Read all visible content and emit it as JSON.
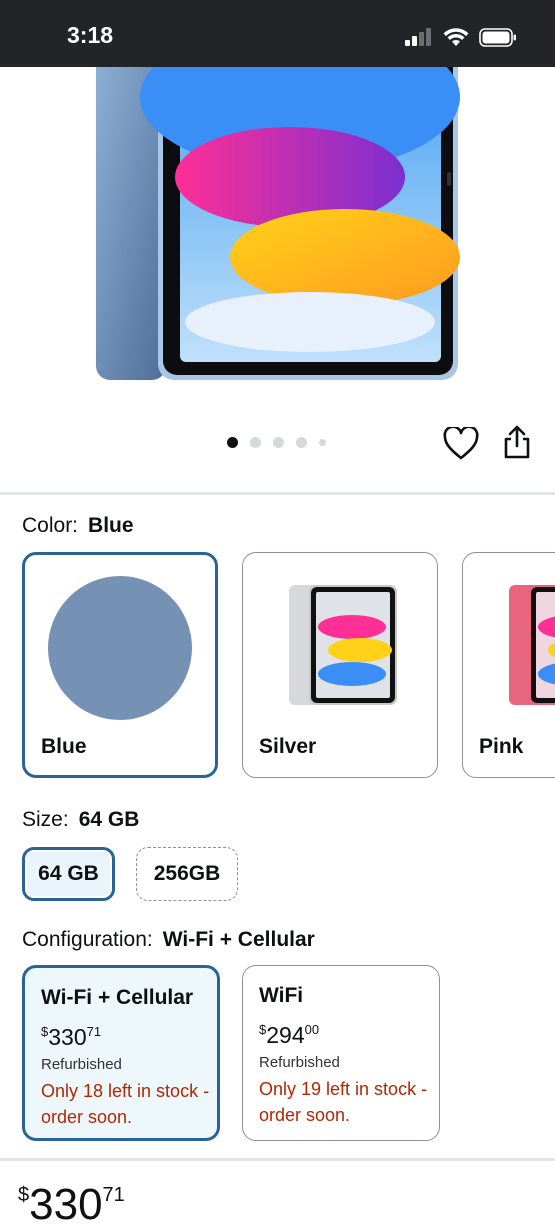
{
  "status_bar": {
    "time": "3:18"
  },
  "gallery": {
    "total_images": 5,
    "active_index": 0
  },
  "color": {
    "label": "Color:",
    "selected": "Blue",
    "options": [
      {
        "name": "Blue"
      },
      {
        "name": "Silver"
      },
      {
        "name": "Pink"
      }
    ]
  },
  "size": {
    "label": "Size:",
    "selected": "64 GB",
    "options": [
      {
        "name": "64 GB"
      },
      {
        "name": "256GB"
      }
    ]
  },
  "configuration": {
    "label": "Configuration:",
    "selected": "Wi-Fi + Cellular",
    "options": [
      {
        "name": "Wi-Fi + Cellular",
        "price_symbol": "$",
        "price_whole": "330",
        "price_fraction": "71",
        "condition": "Refurbished",
        "stock": "Only 18 left in stock - order soon."
      },
      {
        "name": "WiFi",
        "price_symbol": "$",
        "price_whole": "294",
        "price_fraction": "00",
        "condition": "Refurbished",
        "stock": "Only 19 left in stock - order soon."
      }
    ]
  },
  "bottom_price": {
    "symbol": "$",
    "whole": "330",
    "fraction": "71"
  },
  "colors": {
    "accent_border": "#2a6496",
    "stock_red": "#b12704"
  }
}
